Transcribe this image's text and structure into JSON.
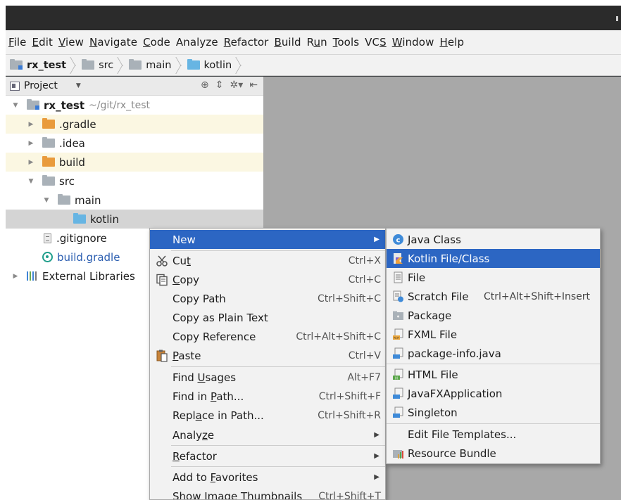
{
  "menubar": [
    {
      "label": "File",
      "mn": 0
    },
    {
      "label": "Edit",
      "mn": 0
    },
    {
      "label": "View",
      "mn": 0
    },
    {
      "label": "Navigate",
      "mn": 0
    },
    {
      "label": "Code",
      "mn": 0
    },
    {
      "label": "Analyze",
      "mn": -1
    },
    {
      "label": "Refactor",
      "mn": 0
    },
    {
      "label": "Build",
      "mn": 0
    },
    {
      "label": "Run",
      "mn": 1
    },
    {
      "label": "Tools",
      "mn": 0
    },
    {
      "label": "VCS",
      "mn": 2
    },
    {
      "label": "Window",
      "mn": 0
    },
    {
      "label": "Help",
      "mn": 0
    }
  ],
  "breadcrumb": {
    "items": [
      "rx_test",
      "src",
      "main",
      "kotlin"
    ]
  },
  "project_panel": {
    "title": "Project",
    "tree": [
      {
        "label": "rx_test",
        "detail": "~/git/rx_test"
      },
      {
        "label": ".gradle"
      },
      {
        "label": ".idea"
      },
      {
        "label": "build"
      },
      {
        "label": "src"
      },
      {
        "label": "main"
      },
      {
        "label": "kotlin"
      },
      {
        "label": ".gitignore"
      },
      {
        "label": "build.gradle"
      },
      {
        "label": "External Libraries"
      }
    ]
  },
  "context_menu": {
    "items": [
      {
        "label": "New",
        "shortcut": "",
        "mn": -1
      },
      {
        "label": "Cut",
        "shortcut": "Ctrl+X",
        "mn": 2
      },
      {
        "label": "Copy",
        "shortcut": "Ctrl+C",
        "mn": 0
      },
      {
        "label": "Copy Path",
        "shortcut": "Ctrl+Shift+C",
        "mn": -1
      },
      {
        "label": "Copy as Plain Text",
        "shortcut": "",
        "mn": -1
      },
      {
        "label": "Copy Reference",
        "shortcut": "Ctrl+Alt+Shift+C",
        "mn": -1
      },
      {
        "label": "Paste",
        "shortcut": "Ctrl+V",
        "mn": 0
      },
      {
        "label": "Find Usages",
        "shortcut": "Alt+F7",
        "mn": 5
      },
      {
        "label": "Find in Path...",
        "shortcut": "Ctrl+Shift+F",
        "mn": 8
      },
      {
        "label": "Replace in Path...",
        "shortcut": "Ctrl+Shift+R",
        "mn": 4
      },
      {
        "label": "Analyze",
        "shortcut": "",
        "mn": 5
      },
      {
        "label": "Refactor",
        "shortcut": "",
        "mn": 0
      },
      {
        "label": "Add to Favorites",
        "shortcut": "",
        "mn": 7
      },
      {
        "label": "Show Image Thumbnails",
        "shortcut": "Ctrl+Shift+T",
        "mn": -1
      }
    ]
  },
  "new_submenu": {
    "items": [
      {
        "label": "Java Class",
        "shortcut": ""
      },
      {
        "label": "Kotlin File/Class",
        "shortcut": ""
      },
      {
        "label": "File",
        "shortcut": ""
      },
      {
        "label": "Scratch File",
        "shortcut": "Ctrl+Alt+Shift+Insert"
      },
      {
        "label": "Package",
        "shortcut": ""
      },
      {
        "label": "FXML File",
        "shortcut": ""
      },
      {
        "label": "package-info.java",
        "shortcut": ""
      },
      {
        "label": "HTML File",
        "shortcut": ""
      },
      {
        "label": "JavaFXApplication",
        "shortcut": ""
      },
      {
        "label": "Singleton",
        "shortcut": ""
      },
      {
        "label": "Edit File Templates...",
        "shortcut": ""
      },
      {
        "label": "Resource Bundle",
        "shortcut": ""
      }
    ]
  },
  "colors": {
    "selection": "#2c66c3",
    "menu_bg": "#f2f2f2",
    "editor_bg": "#a8a8a8",
    "tree_tint": "#fbf7e2"
  },
  "icons": {
    "java_class": "java-class-icon",
    "kotlin": "kotlin-icon",
    "cut": "scissors-icon",
    "copy": "copy-icon",
    "paste": "clipboard-icon"
  }
}
